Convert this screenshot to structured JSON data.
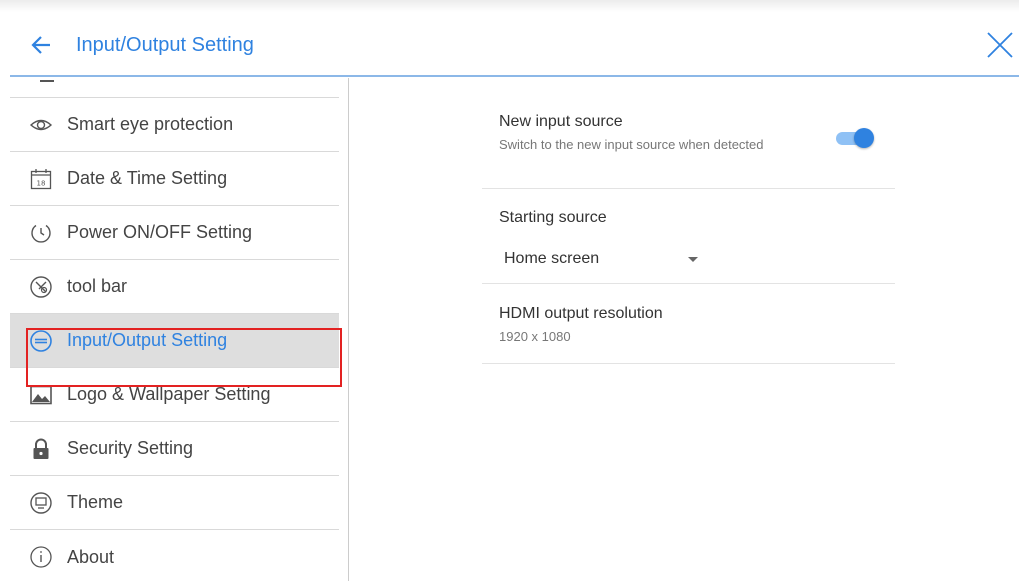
{
  "header": {
    "title": "Input/Output Setting",
    "back_icon": "arrow-left-icon",
    "close_icon": "close-icon",
    "accent_color": "#2f82e0"
  },
  "sidebar": {
    "items": [
      {
        "label": "Smart eye protection",
        "icon": "eye-icon"
      },
      {
        "label": "Date & Time Setting",
        "icon": "calendar-icon",
        "icon_text": "18"
      },
      {
        "label": "Power ON/OFF Setting",
        "icon": "power-timer-icon"
      },
      {
        "label": "tool bar",
        "icon": "toolbar-icon"
      },
      {
        "label": "Input/Output Setting",
        "icon": "input-output-icon",
        "active": true
      },
      {
        "label": "Logo & Wallpaper Setting",
        "icon": "image-icon"
      },
      {
        "label": "Security Setting",
        "icon": "lock-icon"
      },
      {
        "label": "Theme",
        "icon": "theme-icon"
      },
      {
        "label": "About",
        "icon": "info-icon"
      }
    ]
  },
  "settings": {
    "new_input_source": {
      "title": "New input source",
      "subtitle": "Switch to the new input source when detected",
      "enabled": true
    },
    "starting_source": {
      "title": "Starting source",
      "selected": "Home screen"
    },
    "hdmi_output": {
      "title": "HDMI output resolution",
      "value": "1920 x 1080"
    }
  }
}
